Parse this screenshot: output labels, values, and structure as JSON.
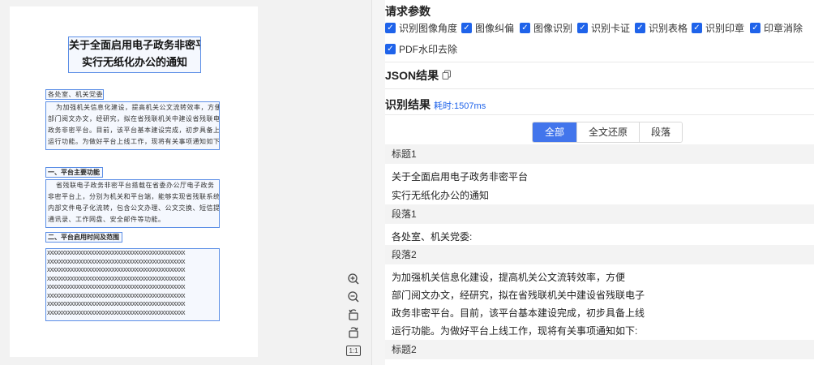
{
  "document": {
    "title_lines": [
      "关于全面启用电子政务非密平台",
      "实行无纸化办公的通知"
    ],
    "salutation": "各处室、机关党委:",
    "para1": [
      "为加强机关信息化建设，提高机关公文流转效率，方便",
      "部门阅文办文，经研究，拟在省残联机关中建设省残联电子",
      "政务非密平台。目前，该平台基本建设完成，初步具备上线",
      "运行功能。为做好平台上线工作，现将有关事项通知如下："
    ],
    "heading1": "一、平台主要功能",
    "para2": [
      "省残联电子政务非密平台搭载在省委办公厅电子政务",
      "非密平台上，分别为机关和平台端，能够实现省残联系统",
      "内部文件电子化流转，包含公文办理、公文交换、短信提醒、",
      "通讯录、工作网盘、安全邮件等功能。"
    ],
    "heading2": "二、平台启用时间及范围",
    "xrows": [
      "XXXXXXXXXXXXXXXXXXXXXXXXXXXXXXXXXXXXXXXXXXXXXXX",
      "XXXXXXXXXXXXXXXXXXXXXXXXXXXXXXXXXXXXXXXXXXXXXXX",
      "XXXXXXXXXXXXXXXXXXXXXXXXXXXXXXXXXXXXXXXXXXXXXXX",
      "XXXXXXXXXXXXXXXXXXXXXXXXXXXXXXXXXXXXXXXXXXXXXXX",
      "XXXXXXXXXXXXXXXXXXXXXXXXXXXXXXXXXXXXXXXXXXXXXXX",
      "XXXXXXXXXXXXXXXXXXXXXXXXXXXXXXXXXXXXXXXXXXXXXXX",
      "XXXXXXXXXXXXXXXXXXXXXXXXXXXXXXXXXXXXXXXXXXXXXXX",
      "XXXXXXXXXXXXXXXXXXXXXXXXXXXXXXXXXXXXXXXXXXXXXXX"
    ]
  },
  "zoom_tools": {
    "zoom_in_icon": "zoom-in-icon",
    "zoom_out_icon": "zoom-out-icon",
    "rotate_left_icon": "rotate-left-icon",
    "rotate_right_icon": "rotate-right-icon",
    "actual_size_label": "1:1"
  },
  "params": {
    "title": "请求参数",
    "options": [
      {
        "label": "识别图像角度",
        "checked": true
      },
      {
        "label": "图像纠偏",
        "checked": true
      },
      {
        "label": "图像识别",
        "checked": true
      },
      {
        "label": "识别卡证",
        "checked": true
      },
      {
        "label": "识别表格",
        "checked": true
      },
      {
        "label": "识别印章",
        "checked": true
      },
      {
        "label": "印章消除",
        "checked": true
      },
      {
        "label": "PDF水印去除",
        "checked": true
      }
    ]
  },
  "json_result": {
    "title": "JSON结果",
    "copy_icon": "copy-icon"
  },
  "result": {
    "title": "识别结果",
    "elapsed": "耗时:1507ms",
    "tabs": [
      {
        "label": "全部",
        "active": true
      },
      {
        "label": "全文还原",
        "active": false
      },
      {
        "label": "段落",
        "active": false
      }
    ],
    "blocks": [
      {
        "header": "标题1",
        "lines": [
          "关于全面启用电子政务非密平台",
          "实行无纸化办公的通知"
        ]
      },
      {
        "header": "段落1",
        "lines": [
          "各处室、机关党委:"
        ]
      },
      {
        "header": "段落2",
        "lines": [
          "为加强机关信息化建设，提高机关公文流转效率，方便",
          "部门阅文办文，经研究，拟在省残联机关中建设省残联电子",
          "政务非密平台。目前，该平台基本建设完成，初步具备上线",
          "运行功能。为做好平台上线工作，现将有关事项通知如下:"
        ]
      },
      {
        "header": "标题2",
        "lines": []
      }
    ]
  },
  "colors": {
    "accent": "#1f63ea",
    "tab_active": "#4275ec",
    "box": "#5b8ee6"
  }
}
